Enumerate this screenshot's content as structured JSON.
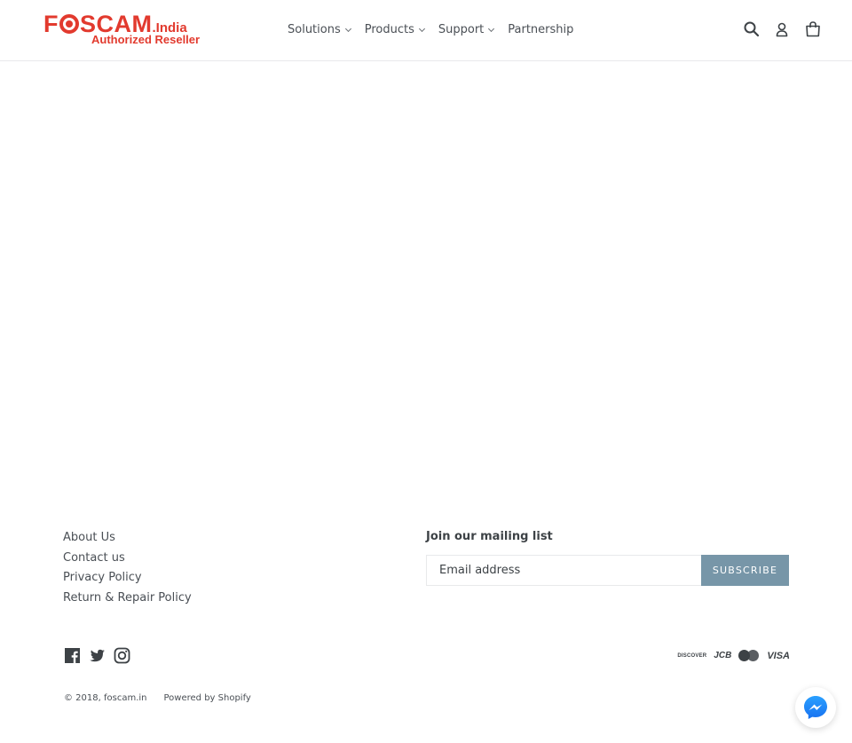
{
  "header": {
    "logo": {
      "brand": "FSCAM",
      "brand_parts": [
        "F",
        "SCAM"
      ],
      "suffix": ".India",
      "tagline": "Authorized Reseller"
    },
    "nav": [
      {
        "label": "Solutions",
        "has_dropdown": true
      },
      {
        "label": "Products",
        "has_dropdown": true
      },
      {
        "label": "Support",
        "has_dropdown": true
      },
      {
        "label": "Partnership",
        "has_dropdown": false
      }
    ],
    "icons": [
      "search-icon",
      "account-icon",
      "cart-icon"
    ]
  },
  "footer": {
    "links": [
      "About Us",
      "Contact us",
      "Privacy Policy",
      "Return & Repair Policy"
    ],
    "mailing": {
      "title": "Join our mailing list",
      "email_placeholder": "Email address",
      "subscribe_label": "SUBSCRIBE"
    },
    "social": [
      "facebook-icon",
      "twitter-icon",
      "instagram-icon"
    ],
    "payment": {
      "discover": "DISCOVER",
      "jcb": "JCB",
      "mastercard": "mastercard",
      "visa": "VISA"
    },
    "copyright": "© 2018, foscam.in",
    "powered_by": "Powered by Shopify"
  },
  "colors": {
    "brand_red": "#e23a2e",
    "button": "#7796a8",
    "text": "#3d4246",
    "messenger_blue": "#1e88f5"
  }
}
